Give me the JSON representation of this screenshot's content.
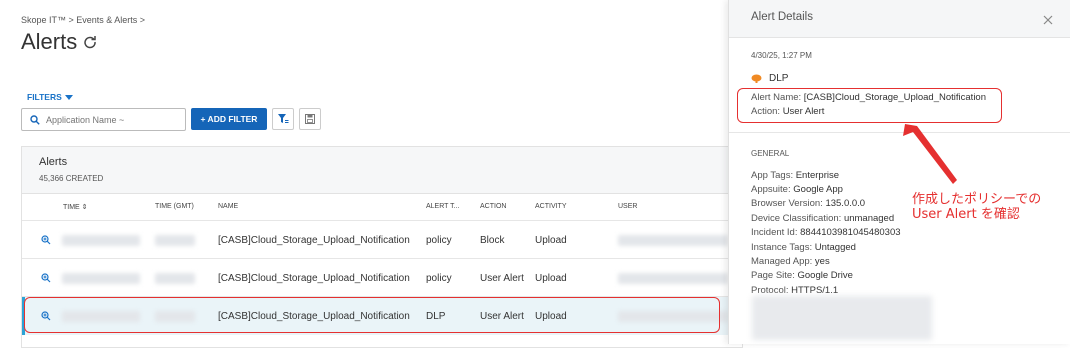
{
  "breadcrumb": "Skope IT™ > Events & Alerts >",
  "page_title": "Alerts",
  "filters_label": "FILTERS",
  "search": {
    "placeholder": "Application Name ~"
  },
  "add_filter_label": "+ ADD FILTER",
  "alerts": {
    "title": "Alerts",
    "count": "45,366 CREATED",
    "columns": [
      "TIME",
      "TIME (GMT)",
      "NAME",
      "ALERT T...",
      "ACTION",
      "ACTIVITY",
      "USER"
    ],
    "rows": [
      {
        "name": "[CASB]Cloud_Storage_Upload_Notification",
        "alert_type": "policy",
        "action": "Block",
        "activity": "Upload"
      },
      {
        "name": "[CASB]Cloud_Storage_Upload_Notification",
        "alert_type": "policy",
        "action": "User Alert",
        "activity": "Upload"
      },
      {
        "name": "[CASB]Cloud_Storage_Upload_Notification",
        "alert_type": "DLP",
        "action": "User Alert",
        "activity": "Upload"
      }
    ]
  },
  "details": {
    "title": "Alert Details",
    "timestamp": "4/30/25, 1:27 PM",
    "category": "DLP",
    "alert_name_label": "Alert Name:",
    "alert_name": "[CASB]Cloud_Storage_Upload_Notification",
    "action_label": "Action:",
    "action": "User Alert",
    "general_label": "GENERAL",
    "general": [
      {
        "k": "App Tags:",
        "v": "Enterprise"
      },
      {
        "k": "Appsuite:",
        "v": "Google App"
      },
      {
        "k": "Browser Version:",
        "v": "135.0.0.0"
      },
      {
        "k": "Device Classification:",
        "v": "unmanaged"
      },
      {
        "k": "Incident Id:",
        "v": "8844103981045480303"
      },
      {
        "k": "Instance Tags:",
        "v": "Untagged"
      },
      {
        "k": "Managed App:",
        "v": "yes"
      },
      {
        "k": "Page Site:",
        "v": "Google Drive"
      },
      {
        "k": "Protocol:",
        "v": "HTTPS/1.1"
      }
    ]
  },
  "annotation": {
    "line1": "作成したポリシーでの",
    "line2": "User Alert を確認",
    "color": "#e53030"
  },
  "colors": {
    "accent": "#1565b8",
    "link": "#1a73c8",
    "highlight": "#e53030",
    "selection": "#2ba3d6"
  }
}
